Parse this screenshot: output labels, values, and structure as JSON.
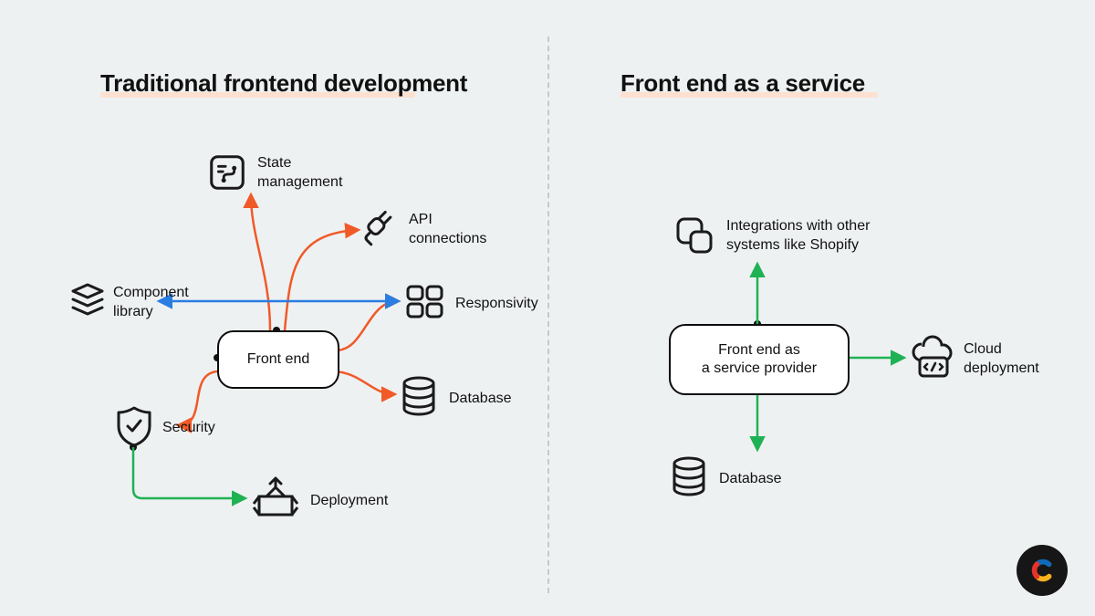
{
  "left": {
    "title": "Traditional frontend development",
    "center_node": "Front end",
    "nodes": {
      "state": "State\nmanagement",
      "api": "API\nconnections",
      "responsivity": "Responsivity",
      "component": "Component\nlibrary",
      "database": "Database",
      "security": "Security",
      "deployment": "Deployment"
    }
  },
  "right": {
    "title": "Front end as a service",
    "center_node": "Front end as\na service provider",
    "nodes": {
      "integrations": "Integrations with other\nsystems like Shopify",
      "cloud": "Cloud\ndeployment",
      "database": "Database"
    }
  },
  "colors": {
    "orange": "#f05a28",
    "blue": "#2a7de1",
    "green": "#1fb254",
    "stroke": "#1b1b1b"
  }
}
